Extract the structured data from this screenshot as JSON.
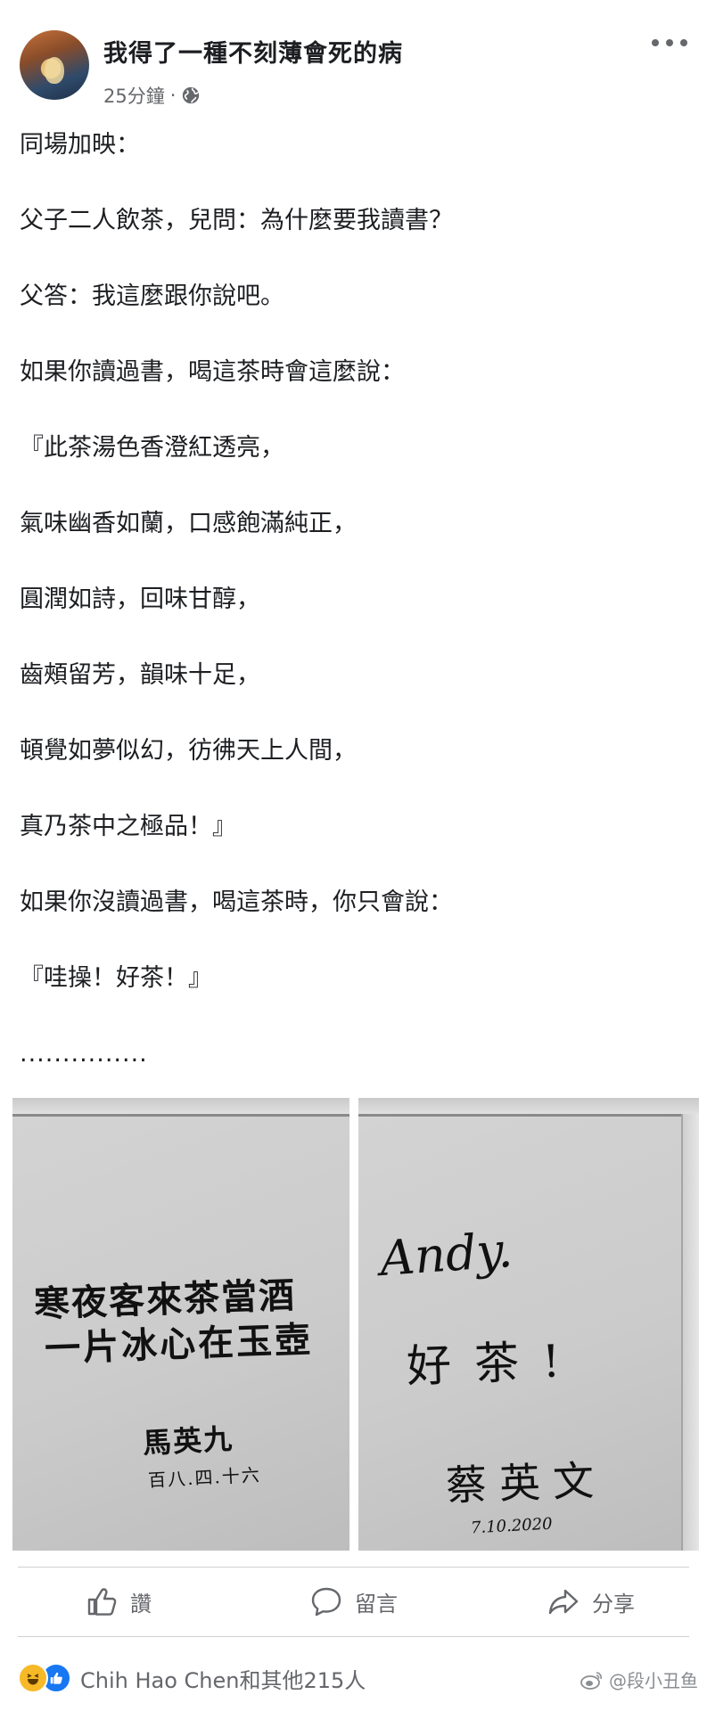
{
  "post": {
    "author": "我得了一種不刻薄會死的病",
    "time": "25分鐘",
    "separator": "·",
    "lines": [
      "同場加映：",
      "父子二人飲茶，兒問：為什麼要我讀書？",
      "父答：我這麼跟你說吧。",
      "如果你讀過書，喝這茶時會這麼說：",
      "『此茶湯色香澄紅透亮，",
      "氣味幽香如蘭，口感飽滿純正，",
      "圓潤如詩，回味甘醇，",
      "齒頰留芳，韻味十足，",
      "頓覺如夢似幻，彷彿天上人間，",
      "真乃茶中之極品！』",
      "如果你沒讀過書，喝這茶時，你只會說：",
      "『哇操！好茶！』",
      "..............."
    ]
  },
  "photos": {
    "left": {
      "line1": "寒夜客來茶當酒",
      "line2": "一片冰心在玉壺",
      "signature": "馬英九",
      "date": "百八.四.十六"
    },
    "right": {
      "line1": "Andy.",
      "line2": "好茶!",
      "signature": "蔡英文",
      "date": "7.10.2020"
    }
  },
  "actions": {
    "like": "讚",
    "comment": "留言",
    "share": "分享"
  },
  "reactions": {
    "text": "Chih Hao Chen和其他215人"
  },
  "watermark": {
    "text": "@段小丑鱼"
  },
  "colors": {
    "text": "#1c1e21",
    "secondary": "#65676b",
    "like_blue": "#1877f2",
    "haha_yellow": "#f7b928",
    "divider": "#ced0d4"
  },
  "icons": {
    "more": "more-horizontal-icon",
    "audience": "globe-icon",
    "like": "thumbs-up-icon",
    "comment": "speech-bubble-icon",
    "share": "share-arrow-icon",
    "reaction_haha": "haha-emoji-icon",
    "reaction_like": "like-emoji-icon",
    "watermark": "weibo-icon"
  }
}
